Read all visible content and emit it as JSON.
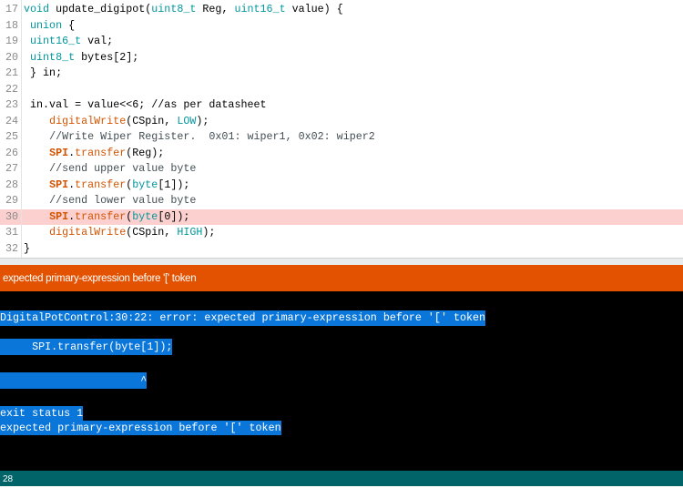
{
  "editor": {
    "highlighted_line": 30,
    "lines": [
      {
        "n": "17",
        "tokens": [
          [
            "void",
            "kw"
          ],
          [
            " update_digipot(",
            ""
          ],
          [
            "uint8_t",
            "kw"
          ],
          [
            " Reg, ",
            ""
          ],
          [
            "uint16_t",
            "kw"
          ],
          [
            " value) {",
            ""
          ]
        ]
      },
      {
        "n": "18",
        "tokens": [
          [
            " ",
            ""
          ],
          [
            "union",
            "kw"
          ],
          [
            " {",
            ""
          ]
        ]
      },
      {
        "n": "19",
        "tokens": [
          [
            " ",
            ""
          ],
          [
            "uint16_t",
            "kw"
          ],
          [
            " val;",
            ""
          ]
        ]
      },
      {
        "n": "20",
        "tokens": [
          [
            " ",
            ""
          ],
          [
            "uint8_t",
            "kw"
          ],
          [
            " bytes[2];",
            ""
          ]
        ]
      },
      {
        "n": "21",
        "tokens": [
          [
            " } in;",
            ""
          ]
        ]
      },
      {
        "n": "22",
        "tokens": []
      },
      {
        "n": "23",
        "tokens": [
          [
            " in.val = value<<6; //as per datasheet",
            ""
          ]
        ]
      },
      {
        "n": "24",
        "tokens": [
          [
            "    ",
            ""
          ],
          [
            "digitalWrite",
            "fn"
          ],
          [
            "(CSpin, ",
            ""
          ],
          [
            "LOW",
            "lit"
          ],
          [
            ");",
            ""
          ]
        ]
      },
      {
        "n": "25",
        "tokens": [
          [
            "    ",
            ""
          ],
          [
            "//Write Wiper Register.  0x01: wiper1, 0x02: wiper2",
            "cm"
          ]
        ]
      },
      {
        "n": "26",
        "tokens": [
          [
            "    ",
            ""
          ],
          [
            "SPI",
            "sp"
          ],
          [
            ".",
            ""
          ],
          [
            "transfer",
            "fn"
          ],
          [
            "(Reg);",
            ""
          ]
        ]
      },
      {
        "n": "27",
        "tokens": [
          [
            "    ",
            ""
          ],
          [
            "//send upper value byte",
            "cm"
          ]
        ]
      },
      {
        "n": "28",
        "tokens": [
          [
            "    ",
            ""
          ],
          [
            "SPI",
            "sp"
          ],
          [
            ".",
            ""
          ],
          [
            "transfer",
            "fn"
          ],
          [
            "(",
            ""
          ],
          [
            "byte",
            "kw"
          ],
          [
            "[1]);",
            ""
          ]
        ]
      },
      {
        "n": "29",
        "tokens": [
          [
            "    ",
            ""
          ],
          [
            "//send lower value byte",
            "cm"
          ]
        ]
      },
      {
        "n": "30",
        "tokens": [
          [
            "    ",
            ""
          ],
          [
            "SPI",
            "sp"
          ],
          [
            ".",
            ""
          ],
          [
            "transfer",
            "fn"
          ],
          [
            "(",
            ""
          ],
          [
            "byte",
            "kw"
          ],
          [
            "[0]);",
            ""
          ]
        ]
      },
      {
        "n": "31",
        "tokens": [
          [
            "    ",
            ""
          ],
          [
            "digitalWrite",
            "fn"
          ],
          [
            "(CSpin, ",
            ""
          ],
          [
            "HIGH",
            "lit"
          ],
          [
            ");",
            ""
          ]
        ]
      },
      {
        "n": "32",
        "tokens": [
          [
            "}",
            ""
          ]
        ]
      }
    ]
  },
  "message_bar": {
    "text": "expected primary-expression before '[' token"
  },
  "console": {
    "lines": [
      "DigitalPotControl:30:22: error: expected primary-expression before '[' token",
      "     SPI.transfer(byte[1]);",
      "                      ^",
      "exit status 1",
      "expected primary-expression before '[' token"
    ]
  },
  "status_bar": {
    "line_number": "28"
  },
  "colors": {
    "error_bar": "#e35200",
    "status_bar": "#006468",
    "selection": "#0a76d9",
    "error_line": "#fdd0d0"
  }
}
